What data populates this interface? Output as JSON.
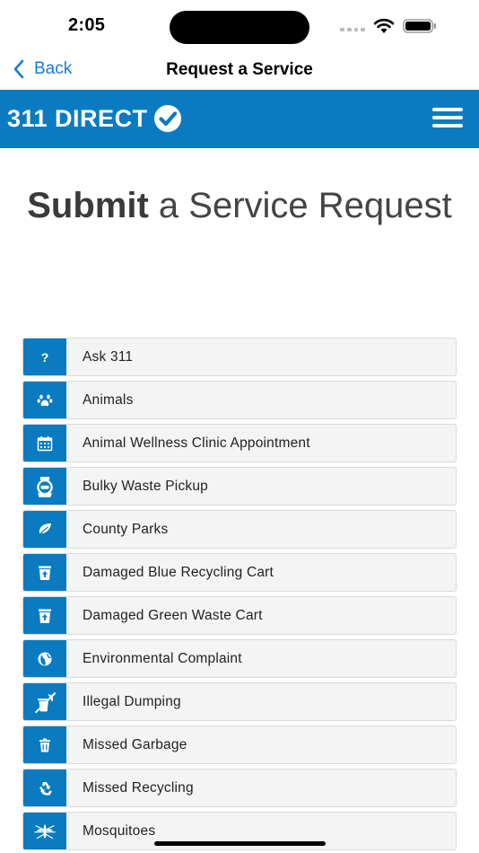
{
  "status": {
    "time": "2:05"
  },
  "nav": {
    "back_label": "Back",
    "title": "Request a Service"
  },
  "brand": {
    "logo_text": "311 DIRECT",
    "color": "#0a7bc1"
  },
  "heading": {
    "bold": "Submit",
    "rest": "a Service Request"
  },
  "services": [
    {
      "label": "Ask 311",
      "icon": "question-icon"
    },
    {
      "label": "Animals",
      "icon": "paw-icon"
    },
    {
      "label": "Animal Wellness Clinic Appointment",
      "icon": "calendar-icon"
    },
    {
      "label": "Bulky Waste Pickup",
      "icon": "bulky-waste-icon"
    },
    {
      "label": "County Parks",
      "icon": "leaf-icon"
    },
    {
      "label": "Damaged Blue Recycling Cart",
      "icon": "cart-upload-icon"
    },
    {
      "label": "Damaged Green Waste Cart",
      "icon": "cart-upload-icon"
    },
    {
      "label": "Environmental Complaint",
      "icon": "globe-icon"
    },
    {
      "label": "Illegal Dumping",
      "icon": "no-dumping-icon"
    },
    {
      "label": "Missed Garbage",
      "icon": "trash-icon"
    },
    {
      "label": "Missed Recycling",
      "icon": "recycle-icon"
    },
    {
      "label": "Mosquitoes",
      "icon": "mosquito-icon"
    }
  ]
}
